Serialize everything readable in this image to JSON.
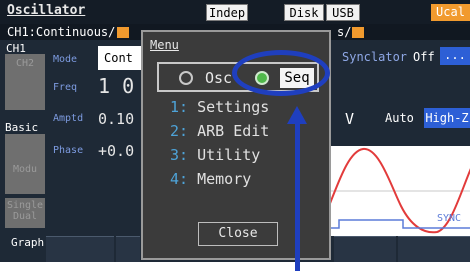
{
  "header": {
    "title": "Oscillator",
    "indep": "Indep",
    "disk": "Disk",
    "usb": "USB",
    "ucal": "Ucal"
  },
  "status": {
    "left": "CH1:Continuous/",
    "right": "s/"
  },
  "tabs": {
    "ch1": "CH1",
    "ch2": "CH2",
    "basic": "Basic",
    "modu": "Modu",
    "single_dual": "Single\nDual",
    "graph": "Graph"
  },
  "params": {
    "mode_label": "Mode",
    "mode_value": "Cont",
    "freq_label": "Freq",
    "freq_value": "1 0",
    "amptd_label": "Amptd",
    "amptd_value": "0.10",
    "phase_label": "Phase",
    "phase_value": "+0.0"
  },
  "right_panel": {
    "synclator": "Synclator",
    "synclator_value": "Off",
    "dots": "...",
    "unit": "V",
    "auto": "Auto",
    "hiz": "High-Z",
    "sync": "SYNC"
  },
  "menu": {
    "title": "Menu",
    "osc": "Osc",
    "seq": "Seq",
    "items": [
      {
        "num": "1:",
        "label": "Settings"
      },
      {
        "num": "2:",
        "label": "ARB Edit"
      },
      {
        "num": "3:",
        "label": "Utility"
      },
      {
        "num": "4:",
        "label": "Memory"
      }
    ],
    "close": "Close"
  },
  "colors": {
    "accent_orange": "#f19a2e",
    "highlight_blue": "#2d5fd6",
    "annotation_blue": "#1f3fbf",
    "radio_green": "#4fb84a"
  }
}
